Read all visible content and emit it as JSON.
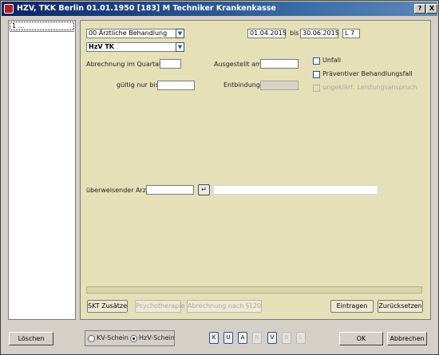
{
  "window": {
    "title": "HZV, TKK Berlin 01.01.1950  [183]  M Techniker Krankenkasse",
    "help_label": "?",
    "close_label": "X"
  },
  "left_panel": {
    "selected_item": "1 ..."
  },
  "form": {
    "treatment_type": "00 Ärztliche Behandlung",
    "date_from": "01.04.2015",
    "bis_label": "bis",
    "date_to": "30.06.2015",
    "l_label": "L",
    "l_value": "7",
    "program": "HzV TK",
    "abrechnung_label": "Abrechnung im Quartal",
    "abrechnung_value": "",
    "ausgestellt_label": "Ausgestellt am",
    "ausgestellt_value": "",
    "gueltig_label": "gültig nur bis",
    "gueltig_value": "",
    "entbindung_label": "Entbindung",
    "entbindung_value": "",
    "unfall_label": "Unfall",
    "praeventiv_label": "Präventiver Behandlungsfall",
    "leistungsanspruch_label": "ungeklärt. Leistungsanspruch",
    "ueberweisender_label": "überweisender Arzt",
    "ueberweisender_value": "",
    "arzt_name_value": "",
    "enter_icon": "↵"
  },
  "actions": {
    "skt": "SKT Zusätze",
    "psycho": "Psychotherapie",
    "abrechnung120": "Abrechnung nach §120",
    "eintragen": "Eintragen",
    "zuruecksetzen": "Zurücksetzen"
  },
  "footer": {
    "loeschen": "Löschen",
    "kv_schein": "KV-Schein",
    "hzv_schein": "HzV-Schein",
    "selected_schein": "HzV-Schein",
    "keys": [
      "K",
      "U",
      "A",
      "N",
      "V",
      "B",
      "L"
    ],
    "ok": "OK",
    "abbrechen": "Abbrechen"
  }
}
